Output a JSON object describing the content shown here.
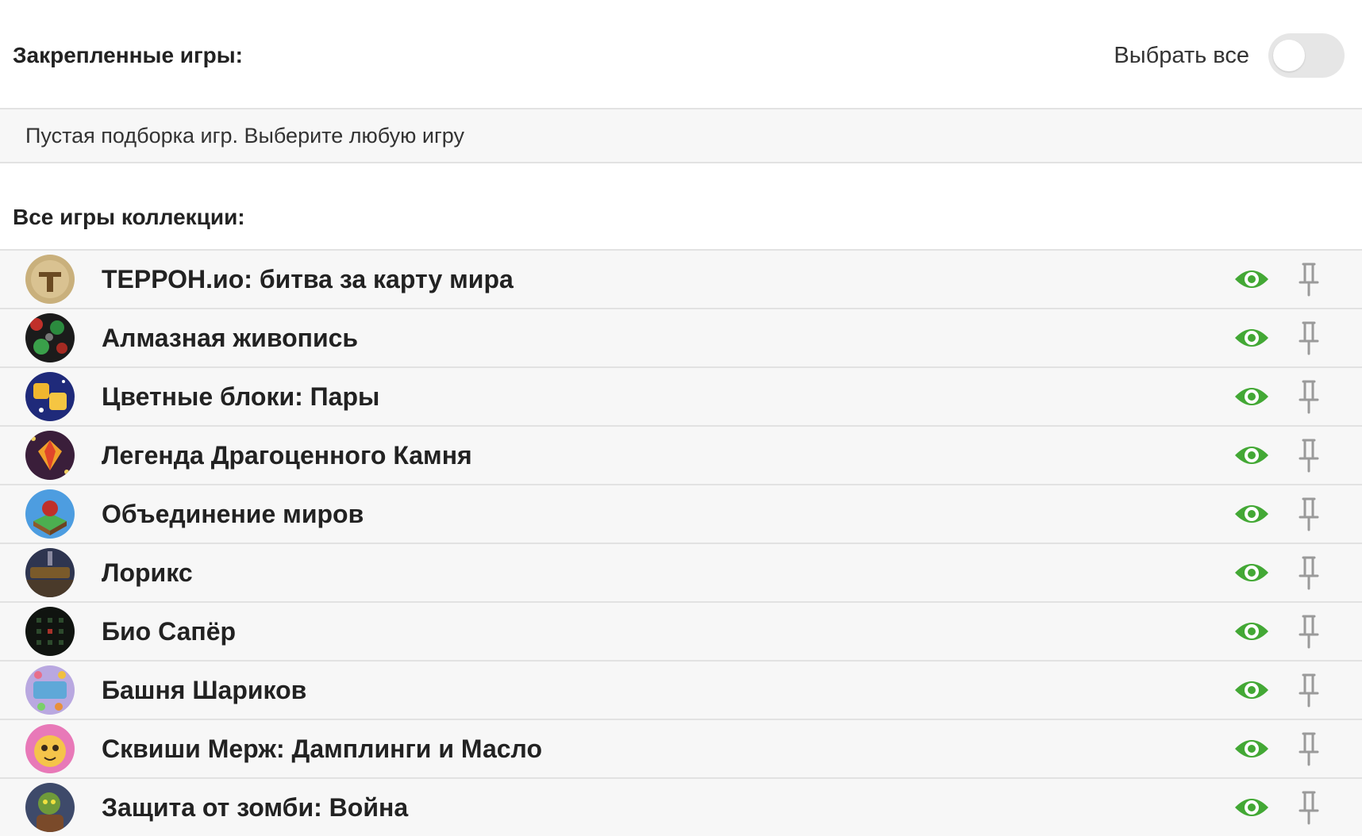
{
  "pinned": {
    "title": "Закрепленные игры:",
    "select_all_label": "Выбрать все",
    "select_all_enabled": false,
    "empty_text": "Пустая подборка игр. Выберите любую игру"
  },
  "collection": {
    "title": "Все игры коллекции:",
    "games": [
      {
        "name": "ТЕРРОН.ио: битва за карту мира",
        "visible": true,
        "pinned": false
      },
      {
        "name": "Алмазная живопись",
        "visible": true,
        "pinned": false
      },
      {
        "name": "Цветные блоки: Пары",
        "visible": true,
        "pinned": false
      },
      {
        "name": "Легенда Драгоценного Камня",
        "visible": true,
        "pinned": false
      },
      {
        "name": "Объединение миров",
        "visible": true,
        "pinned": false
      },
      {
        "name": "Лорикс",
        "visible": true,
        "pinned": false
      },
      {
        "name": "Био Сапёр",
        "visible": true,
        "pinned": false
      },
      {
        "name": "Башня Шариков",
        "visible": true,
        "pinned": false
      },
      {
        "name": "Сквиши Мерж: Дамплинги и Масло",
        "visible": true,
        "pinned": false
      },
      {
        "name": "Защита от зомби: Война",
        "visible": true,
        "pinned": false
      }
    ]
  },
  "colors": {
    "eye_icon": "#43a835",
    "pin_icon": "#9a9a9a",
    "row_background": "#f7f7f7",
    "divider": "#e2e2e2",
    "toggle_off": "#e6e6e6"
  },
  "icons": {
    "visibility": "eye-icon",
    "pin": "pin-icon"
  }
}
